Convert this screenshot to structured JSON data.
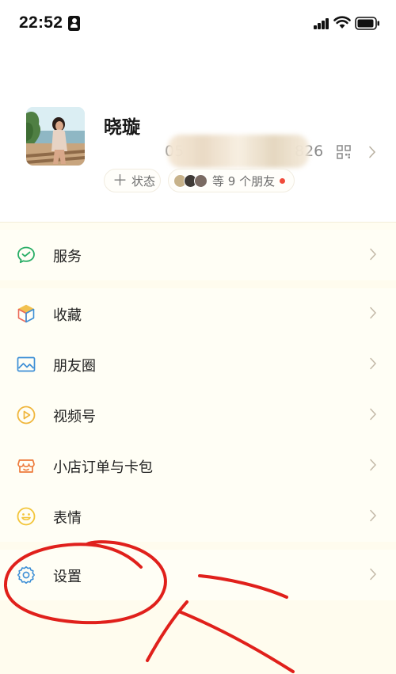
{
  "status_bar": {
    "time": "22:52"
  },
  "profile": {
    "name": "晓璇",
    "wechat_id_visible": "05",
    "wechat_id_suffix": "826",
    "status_label": "状态",
    "status_plus": "＋",
    "friends_text": "等 9 个朋友"
  },
  "menu": {
    "items": [
      {
        "label": "服务",
        "icon": "wechat-pay-icon"
      },
      {
        "label": "收藏",
        "icon": "favorites-cube-icon"
      },
      {
        "label": "朋友圈",
        "icon": "moments-image-icon"
      },
      {
        "label": "视频号",
        "icon": "channels-play-icon"
      },
      {
        "label": "小店订单与卡包",
        "icon": "shop-card-icon"
      },
      {
        "label": "表情",
        "icon": "sticker-smile-icon"
      },
      {
        "label": "设置",
        "icon": "settings-gear-icon"
      }
    ]
  },
  "colors": {
    "services_icon": "#2aae67",
    "favorites_icon": "#e8b54a",
    "moments_icon": "#3d8fd6",
    "channels_icon": "#f0b63c",
    "shop_icon": "#ee7a3b",
    "sticker_icon": "#f3c53a",
    "settings_icon": "#3d8fd6",
    "annotation_red": "#e0201b",
    "background": "#fffdf1"
  }
}
